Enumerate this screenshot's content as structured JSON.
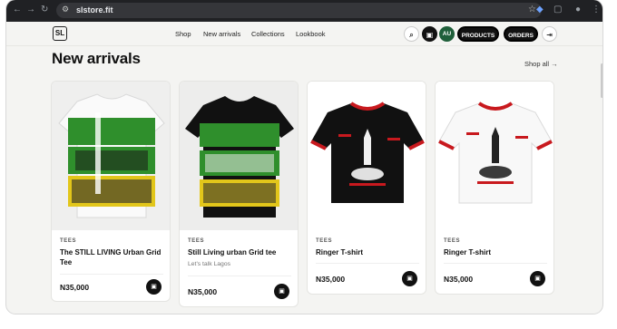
{
  "browser": {
    "url": "slstore.fit",
    "back_icon": "arrow-left",
    "forward_icon": "arrow-right",
    "reload_icon": "reload"
  },
  "header": {
    "logo_text": "SL",
    "nav": [
      "Shop",
      "New arrivals",
      "Collections",
      "Lookbook"
    ],
    "search_icon": "⌕",
    "cart_icon": "▣",
    "avatar": "AU",
    "products_label": "PRODUCTS",
    "orders_label": "ORDERS",
    "logout_icon": "⇥"
  },
  "section": {
    "title": "New arrivals",
    "shop_all": "Shop all →"
  },
  "products": [
    {
      "category": "TEES",
      "name": "The STILL LIVING Urban Grid Tee",
      "subtitle": "",
      "price": "N35,000"
    },
    {
      "category": "TEES",
      "name": "Still Living urban Grid tee",
      "subtitle": "Let's talk Lagos",
      "price": "N35,000"
    },
    {
      "category": "TEES",
      "name": "Ringer T-shirt",
      "subtitle": "",
      "price": "N35,000"
    },
    {
      "category": "TEES",
      "name": "Ringer T-shirt",
      "subtitle": "",
      "price": "N35,000"
    }
  ],
  "colors": {
    "accent_dark": "#111111",
    "avatar_bg": "#1f5f3a",
    "print_green": "#2f8f2c",
    "print_yellow": "#e2c61a",
    "ringer_red": "#c8191e"
  }
}
